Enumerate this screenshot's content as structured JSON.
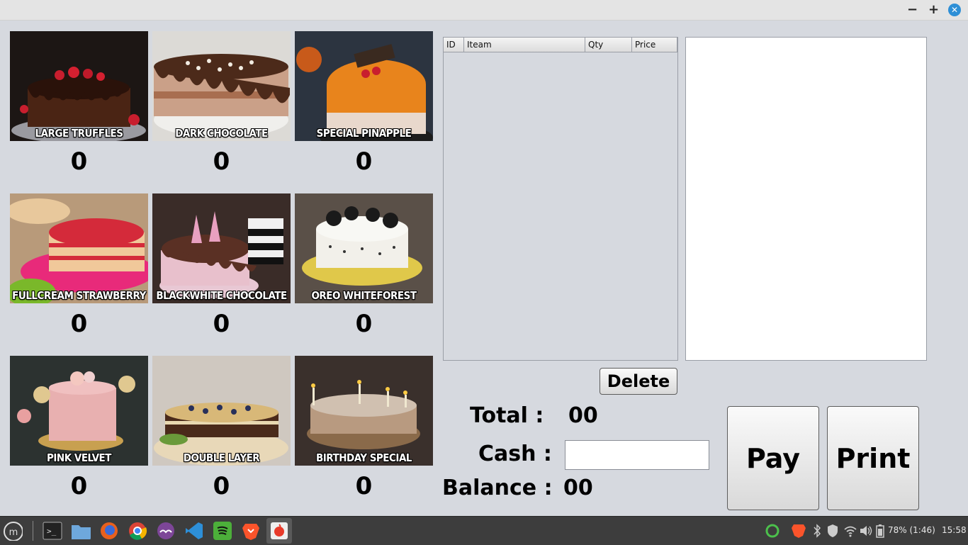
{
  "window": {
    "min": "−",
    "max": "+",
    "close": "✕"
  },
  "products": [
    {
      "name": "LARGE TRUFFLES",
      "qty": "0"
    },
    {
      "name": "DARK CHOCOLATE",
      "qty": "0"
    },
    {
      "name": "SPECIAL PINAPPLE",
      "qty": "0"
    },
    {
      "name": "FULLCREAM STRAWBERRY",
      "qty": "0"
    },
    {
      "name": "BLACKWHITE CHOCOLATE",
      "qty": "0"
    },
    {
      "name": "OREO WHITEFOREST",
      "qty": "0"
    },
    {
      "name": "PINK VELVET",
      "qty": "0"
    },
    {
      "name": "DOUBLE LAYER",
      "qty": "0"
    },
    {
      "name": "BIRTHDAY SPECIAL",
      "qty": "0"
    }
  ],
  "table": {
    "columns": [
      "ID",
      "Iteam",
      "Qty",
      "Price"
    ]
  },
  "buttons": {
    "delete": "Delete",
    "pay": "Pay",
    "print": "Print"
  },
  "summary": {
    "total_label": "Total :",
    "total_value": "00",
    "cash_label": "Cash :",
    "cash_value": "",
    "balance_label": "Balance :",
    "balance_value": "00"
  },
  "taskbar": {
    "battery": "78% (1:46)",
    "clock": "15:58",
    "apps": [
      "mint-menu-icon",
      "terminal-icon",
      "files-icon",
      "firefox-icon",
      "chrome-icon",
      "tor-icon",
      "vscode-icon",
      "spotify-icon",
      "brave-icon",
      "java-app-icon"
    ]
  }
}
